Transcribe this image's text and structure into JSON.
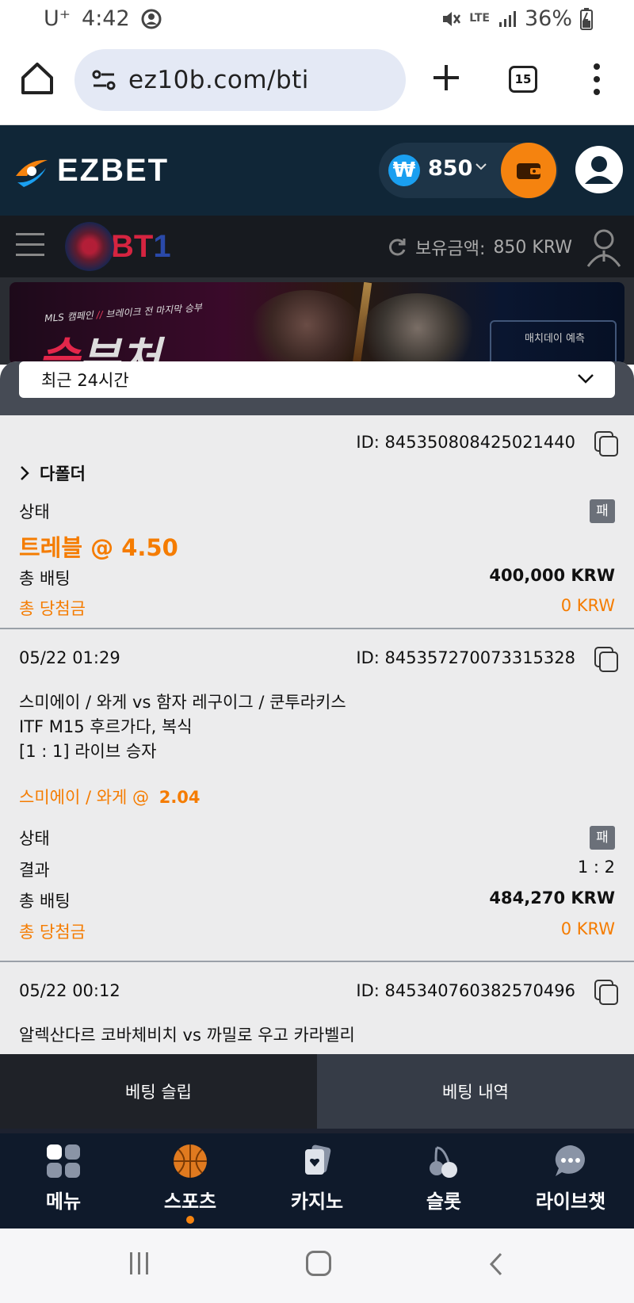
{
  "status_bar": {
    "carrier": "U⁺",
    "time": "4:42",
    "network": "LTE",
    "battery": "36%"
  },
  "browser": {
    "url": "ez10b.com/bti",
    "tab_count": "15"
  },
  "app": {
    "brand": "EZBET",
    "currency_symbol": "₩",
    "balance": "850",
    "brand_color": "#f5830f",
    "header_bg": "#102637"
  },
  "bti": {
    "logo_text_a": "BT",
    "logo_text_b": "1",
    "balance_label": "보유금액:",
    "balance_value": "850 KRW"
  },
  "banner": {
    "tag_a": "MLS 캠페인",
    "tag_sep": "//",
    "tag_b": "브레이크 전 마지막 승부",
    "big_a": "승",
    "big_b": "부처",
    "box_text": "매치데이 예측"
  },
  "filter": {
    "period": "최근 24시간"
  },
  "bets": [
    {
      "id": "ID: 845350808425021440",
      "folder_label": "다폴더",
      "status_label": "상태",
      "status_badge": "패",
      "selection": "트레블 @ 4.50",
      "stake_label": "총 배팅",
      "stake": "400,000 KRW",
      "payout_label": "총 당첨금",
      "payout": "0 KRW"
    },
    {
      "date": "05/22 01:29",
      "id": "ID: 845357270073315328",
      "match": "스미에이 / 와게 vs 함자 레구이그 / 쿤투라키스",
      "league": "ITF M15 후르가다, 복식",
      "market": "[1 : 1] 라이브 승자",
      "pick": "스미에이 / 와게 @",
      "odds": "2.04",
      "status_label": "상태",
      "status_badge": "패",
      "result_label": "결과",
      "result": "1 : 2",
      "stake_label": "총 배팅",
      "stake": "484,270 KRW",
      "payout_label": "총 당첨금",
      "payout": "0 KRW"
    },
    {
      "date": "05/22 00:12",
      "id": "ID: 845340760382570496",
      "match": "알렉산다르 코바체비치 vs 까밀로 우고 카라벨리"
    }
  ],
  "slip_tabs": {
    "slip": "베팅 슬립",
    "history": "베팅 내역"
  },
  "bottom_nav": [
    {
      "label": "메뉴",
      "icon": "menu-grid-icon"
    },
    {
      "label": "스포츠",
      "icon": "basketball-icon",
      "active": true
    },
    {
      "label": "카지노",
      "icon": "cards-icon"
    },
    {
      "label": "슬롯",
      "icon": "cherry-icon"
    },
    {
      "label": "라이브챗",
      "icon": "chat-icon"
    }
  ]
}
